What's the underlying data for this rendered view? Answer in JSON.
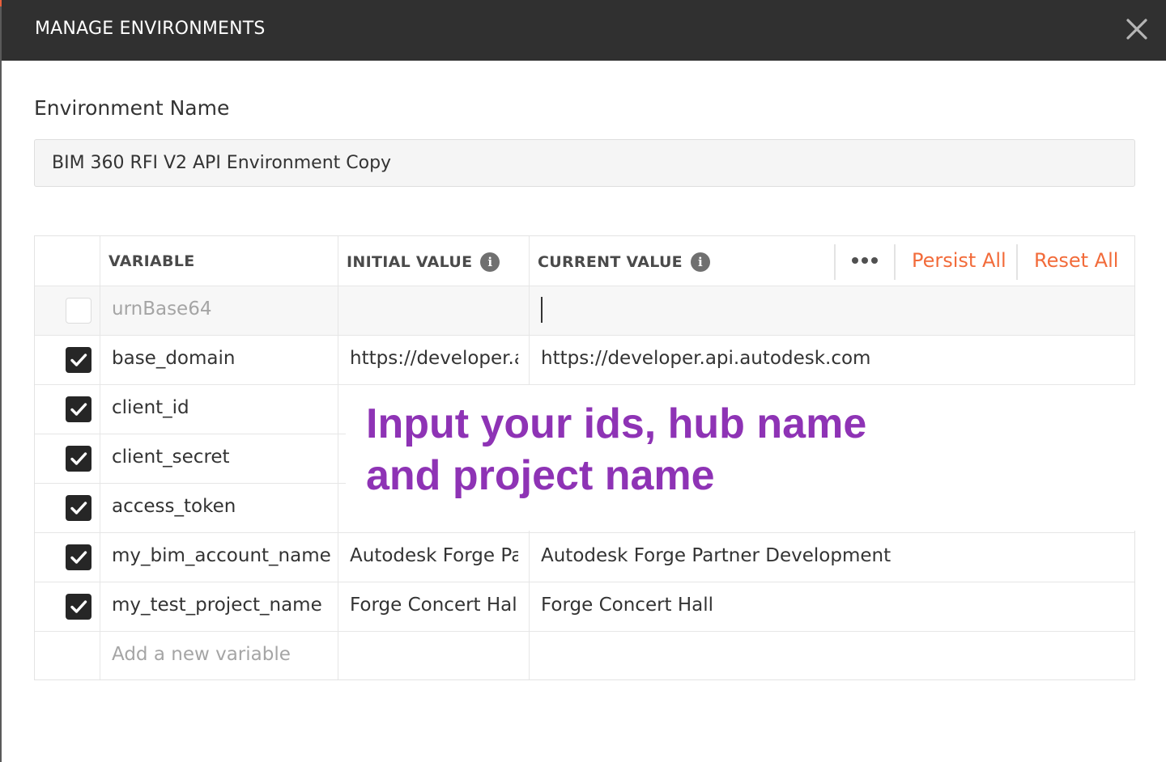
{
  "dialog": {
    "title": "MANAGE ENVIRONMENTS",
    "close_icon": "close-icon"
  },
  "environment": {
    "label": "Environment Name",
    "value": "BIM 360 RFI V2 API Environment Copy"
  },
  "table": {
    "headers": {
      "variable": "VARIABLE",
      "initial_value": "INITIAL VALUE",
      "current_value": "CURRENT VALUE",
      "info_glyph": "i"
    },
    "more_actions_icon": "more-horizontal-icon",
    "persist_all": "Persist All",
    "reset_all": "Reset All",
    "rows": [
      {
        "enabled": false,
        "variable": "urnBase64",
        "initial_value": "",
        "current_value": ""
      },
      {
        "enabled": true,
        "variable": "base_domain",
        "initial_value": "https://developer.api.autodesk.com",
        "current_value": "https://developer.api.autodesk.com"
      },
      {
        "enabled": true,
        "variable": "client_id",
        "initial_value": "",
        "current_value": ""
      },
      {
        "enabled": true,
        "variable": "client_secret",
        "initial_value": "",
        "current_value": ""
      },
      {
        "enabled": true,
        "variable": "access_token",
        "initial_value": "",
        "current_value": ""
      },
      {
        "enabled": true,
        "variable": "my_bim_account_name",
        "initial_value": "Autodesk Forge Partner Development",
        "current_value": "Autodesk Forge Partner Development"
      },
      {
        "enabled": true,
        "variable": "my_test_project_name",
        "initial_value": "Forge Concert Hall",
        "current_value": "Forge Concert Hall"
      }
    ],
    "add_placeholder": "Add a new variable"
  },
  "annotation": {
    "line1": "Input your ids, hub name",
    "line2": "and project name"
  },
  "colors": {
    "titlebar": "#303030",
    "accent_orange": "#f26b3a",
    "annotation_purple": "#8e33b5",
    "checkbox": "#262626"
  }
}
